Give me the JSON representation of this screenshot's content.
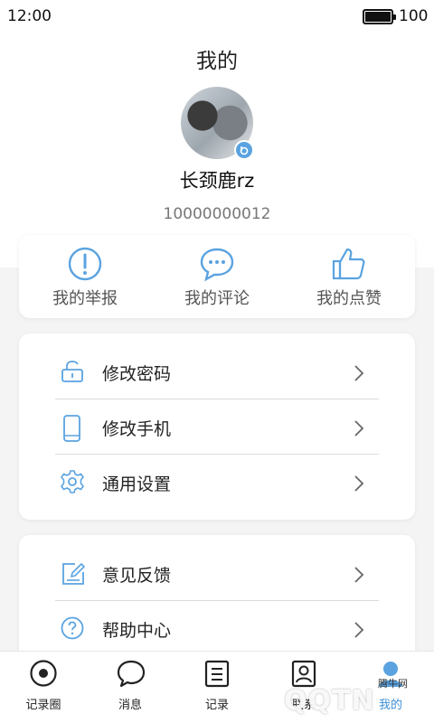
{
  "status_bar": {
    "time": "12:00",
    "battery": "100"
  },
  "header": {
    "title": "我的"
  },
  "profile": {
    "username": "长颈鹿rz",
    "user_id": "10000000012"
  },
  "quick_actions": [
    {
      "label": "我的举报",
      "icon": "exclamation-circle-icon"
    },
    {
      "label": "我的评论",
      "icon": "comment-bubble-icon"
    },
    {
      "label": "我的点赞",
      "icon": "thumbs-up-icon"
    }
  ],
  "menu_group_1": [
    {
      "label": "修改密码",
      "icon": "lock-icon"
    },
    {
      "label": "修改手机",
      "icon": "phone-icon"
    },
    {
      "label": "通用设置",
      "icon": "gear-icon"
    }
  ],
  "menu_group_2": [
    {
      "label": "意见反馈",
      "icon": "edit-icon"
    },
    {
      "label": "帮助中心",
      "icon": "question-icon"
    }
  ],
  "tabs": [
    {
      "label": "记录圈",
      "icon": "eye-icon"
    },
    {
      "label": "消息",
      "icon": "chat-icon"
    },
    {
      "label": "记录",
      "icon": "list-icon"
    },
    {
      "label": "联系",
      "icon": "contacts-icon"
    },
    {
      "label": "我的",
      "icon": "user-icon",
      "active": true
    }
  ],
  "watermark": {
    "text": "QQTN",
    "small": "腾牛网"
  },
  "colors": {
    "accent": "#5aa3e0",
    "active_tab": "#3d8fd6",
    "background": "#f4f4f4"
  }
}
